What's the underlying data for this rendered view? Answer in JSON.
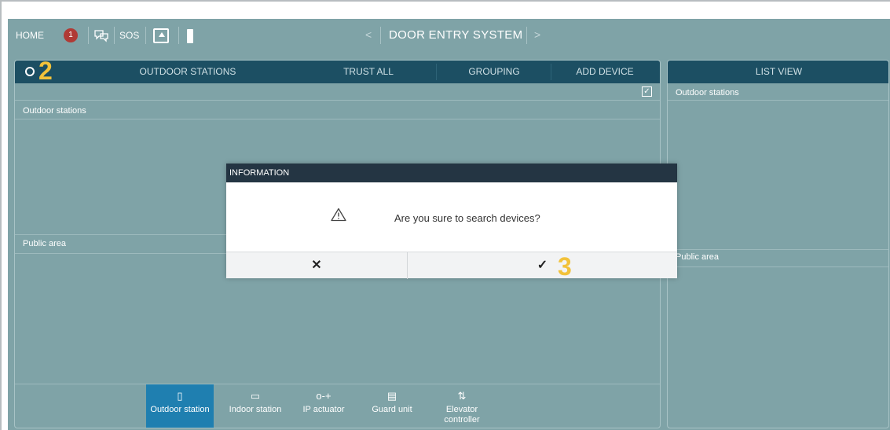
{
  "topbar": {
    "home_label": "HOME",
    "alarm_count": "1",
    "sos_label": "SOS",
    "nav_prev": "<",
    "title": "DOOR ENTRY SYSTEM",
    "nav_next": ">"
  },
  "main_panel": {
    "tabs": [
      "OUTDOOR STATIONS",
      "TRUST ALL",
      "GROUPING",
      "ADD DEVICE"
    ],
    "annotation_2": "2",
    "section_outdoor": "Outdoor stations",
    "section_public": "Public area",
    "device_tabs": [
      {
        "label": "Outdoor station",
        "icon": "outdoor-station-icon",
        "glyph": "▯"
      },
      {
        "label": "Indoor station",
        "icon": "indoor-station-icon",
        "glyph": "▭"
      },
      {
        "label": "IP actuator",
        "icon": "key-icon",
        "glyph": "o-+"
      },
      {
        "label": "Guard unit",
        "icon": "guard-unit-icon",
        "glyph": "▤"
      },
      {
        "label": "Elevator controller",
        "icon": "elevator-icon",
        "glyph": "⇅"
      }
    ]
  },
  "side_panel": {
    "header": "LIST VIEW",
    "section_outdoor": "Outdoor stations",
    "section_public": "Public area"
  },
  "dialog": {
    "title": "INFORMATION",
    "message": "Are you sure to search devices?",
    "cancel_glyph": "✕",
    "confirm_glyph": "✓",
    "annotation_3": "3"
  },
  "colors": {
    "background": "#7fa3a7",
    "header_bar": "#1c4f63",
    "active_tab": "#1f7fb0",
    "dialog_header": "#243543",
    "annotation": "#f2c23a",
    "alarm_badge": "#b03a35"
  }
}
